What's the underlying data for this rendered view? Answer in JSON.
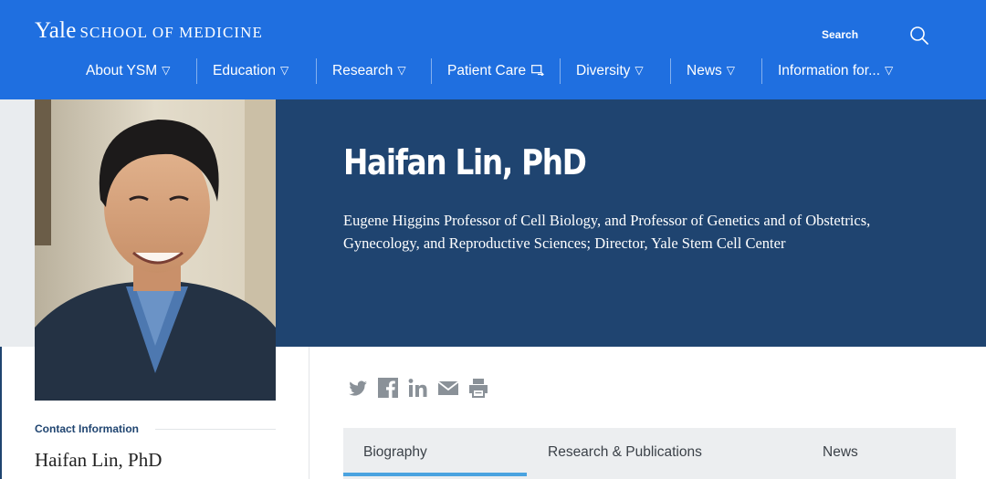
{
  "header": {
    "logo_yale": "Yale",
    "logo_school": "SCHOOL OF MEDICINE",
    "search_label": "Search",
    "brand_color": "#1f6fe0"
  },
  "nav": {
    "items": [
      {
        "label": "About YSM",
        "icon": "triangle-down-icon"
      },
      {
        "label": "Education",
        "icon": "triangle-down-icon"
      },
      {
        "label": "Research",
        "icon": "triangle-down-icon"
      },
      {
        "label": "Patient Care",
        "icon": "external-link-icon"
      },
      {
        "label": "Diversity",
        "icon": "triangle-down-icon"
      },
      {
        "label": "News",
        "icon": "triangle-down-icon"
      },
      {
        "label": "Information for...",
        "icon": "triangle-down-icon"
      }
    ]
  },
  "profile": {
    "name": "Haifan Lin, PhD",
    "appointment": "Eugene Higgins Professor of Cell Biology, and Professor of Genetics and of Obstetrics, Gynecology, and Reproductive Sciences; Director, Yale Stem Cell Center",
    "hero_color": "#1f4470"
  },
  "contact": {
    "heading": "Contact Information",
    "name": "Haifan Lin, PhD"
  },
  "share_icons": [
    "twitter-icon",
    "facebook-icon",
    "linkedin-icon",
    "email-icon",
    "print-icon"
  ],
  "tabs": {
    "items": [
      {
        "label": "Biography",
        "active": true
      },
      {
        "label": "Research & Publications",
        "active": false
      },
      {
        "label": "News",
        "active": false
      }
    ],
    "active_color": "#4aa3e0"
  }
}
